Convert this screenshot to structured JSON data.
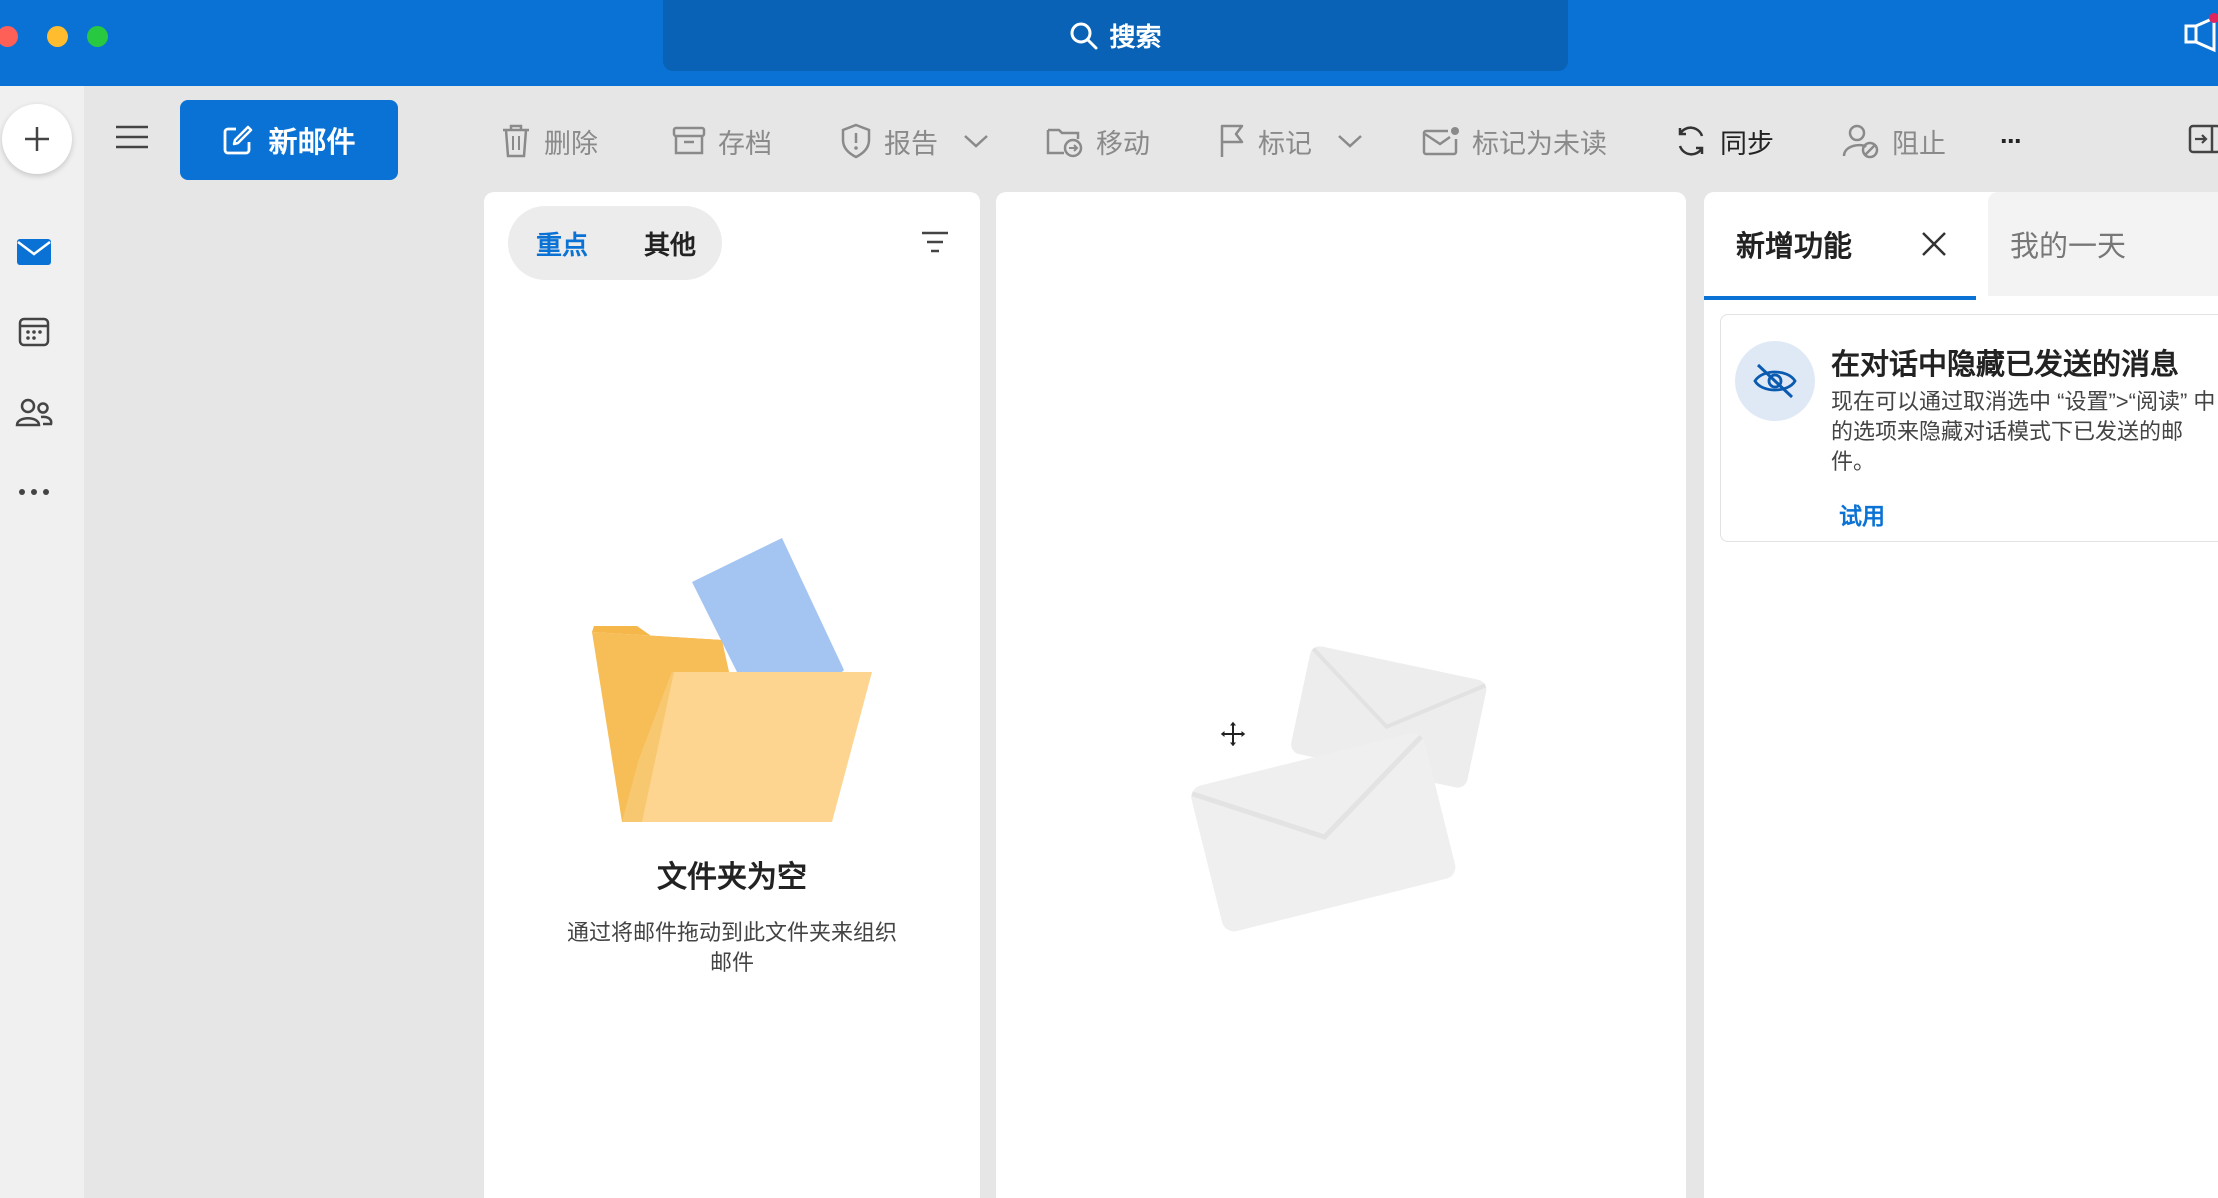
{
  "window": {
    "traffic_lights": [
      "#fe5f57",
      "#febc2e",
      "#28c840"
    ],
    "accent": "#0a72d4"
  },
  "search": {
    "label": "搜索",
    "icon": "search-icon"
  },
  "rail": {
    "items": [
      {
        "name": "mail",
        "icon": "mail-icon"
      },
      {
        "name": "calendar",
        "icon": "calendar-icon"
      },
      {
        "name": "people",
        "icon": "people-icon"
      },
      {
        "name": "more",
        "icon": "more-icon"
      }
    ]
  },
  "compose": {
    "label": "新邮件",
    "icon": "compose-icon"
  },
  "toolbar": {
    "delete": "删除",
    "archive": "存档",
    "report": "报告",
    "move": "移动",
    "flag": "标记",
    "mark_unread": "标记为未读",
    "sync": "同步",
    "block": "阻止",
    "more": "···"
  },
  "message_list": {
    "tabs": [
      {
        "label": "重点",
        "selected": true
      },
      {
        "label": "其他",
        "selected": false
      }
    ],
    "empty_title": "文件夹为空",
    "empty_subtitle": "通过将邮件拖动到此文件夹来组织邮件"
  },
  "right_pane": {
    "tab_whats_new": "新增功能",
    "tab_my_day": "我的一天",
    "card": {
      "title": "在对话中隐藏已发送的消息",
      "body": "现在可以通过取消选中 “设置”>“阅读” 中的选项来隐藏对话模式下已发送的邮件。",
      "action": "试用"
    }
  }
}
